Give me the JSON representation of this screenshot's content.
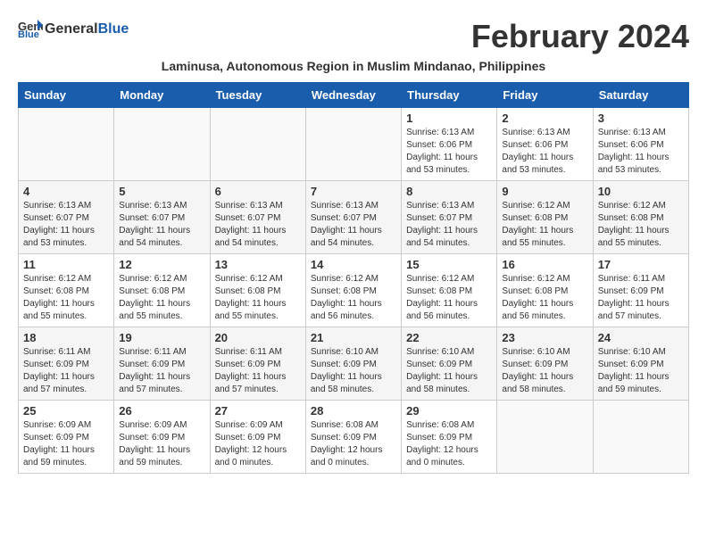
{
  "header": {
    "logo_general": "General",
    "logo_blue": "Blue",
    "month_title": "February 2024",
    "location": "Laminusa, Autonomous Region in Muslim Mindanao, Philippines"
  },
  "days_of_week": [
    "Sunday",
    "Monday",
    "Tuesday",
    "Wednesday",
    "Thursday",
    "Friday",
    "Saturday"
  ],
  "weeks": [
    [
      {
        "day": "",
        "info": ""
      },
      {
        "day": "",
        "info": ""
      },
      {
        "day": "",
        "info": ""
      },
      {
        "day": "",
        "info": ""
      },
      {
        "day": "1",
        "info": "Sunrise: 6:13 AM\nSunset: 6:06 PM\nDaylight: 11 hours\nand 53 minutes."
      },
      {
        "day": "2",
        "info": "Sunrise: 6:13 AM\nSunset: 6:06 PM\nDaylight: 11 hours\nand 53 minutes."
      },
      {
        "day": "3",
        "info": "Sunrise: 6:13 AM\nSunset: 6:06 PM\nDaylight: 11 hours\nand 53 minutes."
      }
    ],
    [
      {
        "day": "4",
        "info": "Sunrise: 6:13 AM\nSunset: 6:07 PM\nDaylight: 11 hours\nand 53 minutes."
      },
      {
        "day": "5",
        "info": "Sunrise: 6:13 AM\nSunset: 6:07 PM\nDaylight: 11 hours\nand 54 minutes."
      },
      {
        "day": "6",
        "info": "Sunrise: 6:13 AM\nSunset: 6:07 PM\nDaylight: 11 hours\nand 54 minutes."
      },
      {
        "day": "7",
        "info": "Sunrise: 6:13 AM\nSunset: 6:07 PM\nDaylight: 11 hours\nand 54 minutes."
      },
      {
        "day": "8",
        "info": "Sunrise: 6:13 AM\nSunset: 6:07 PM\nDaylight: 11 hours\nand 54 minutes."
      },
      {
        "day": "9",
        "info": "Sunrise: 6:12 AM\nSunset: 6:08 PM\nDaylight: 11 hours\nand 55 minutes."
      },
      {
        "day": "10",
        "info": "Sunrise: 6:12 AM\nSunset: 6:08 PM\nDaylight: 11 hours\nand 55 minutes."
      }
    ],
    [
      {
        "day": "11",
        "info": "Sunrise: 6:12 AM\nSunset: 6:08 PM\nDaylight: 11 hours\nand 55 minutes."
      },
      {
        "day": "12",
        "info": "Sunrise: 6:12 AM\nSunset: 6:08 PM\nDaylight: 11 hours\nand 55 minutes."
      },
      {
        "day": "13",
        "info": "Sunrise: 6:12 AM\nSunset: 6:08 PM\nDaylight: 11 hours\nand 55 minutes."
      },
      {
        "day": "14",
        "info": "Sunrise: 6:12 AM\nSunset: 6:08 PM\nDaylight: 11 hours\nand 56 minutes."
      },
      {
        "day": "15",
        "info": "Sunrise: 6:12 AM\nSunset: 6:08 PM\nDaylight: 11 hours\nand 56 minutes."
      },
      {
        "day": "16",
        "info": "Sunrise: 6:12 AM\nSunset: 6:08 PM\nDaylight: 11 hours\nand 56 minutes."
      },
      {
        "day": "17",
        "info": "Sunrise: 6:11 AM\nSunset: 6:09 PM\nDaylight: 11 hours\nand 57 minutes."
      }
    ],
    [
      {
        "day": "18",
        "info": "Sunrise: 6:11 AM\nSunset: 6:09 PM\nDaylight: 11 hours\nand 57 minutes."
      },
      {
        "day": "19",
        "info": "Sunrise: 6:11 AM\nSunset: 6:09 PM\nDaylight: 11 hours\nand 57 minutes."
      },
      {
        "day": "20",
        "info": "Sunrise: 6:11 AM\nSunset: 6:09 PM\nDaylight: 11 hours\nand 57 minutes."
      },
      {
        "day": "21",
        "info": "Sunrise: 6:10 AM\nSunset: 6:09 PM\nDaylight: 11 hours\nand 58 minutes."
      },
      {
        "day": "22",
        "info": "Sunrise: 6:10 AM\nSunset: 6:09 PM\nDaylight: 11 hours\nand 58 minutes."
      },
      {
        "day": "23",
        "info": "Sunrise: 6:10 AM\nSunset: 6:09 PM\nDaylight: 11 hours\nand 58 minutes."
      },
      {
        "day": "24",
        "info": "Sunrise: 6:10 AM\nSunset: 6:09 PM\nDaylight: 11 hours\nand 59 minutes."
      }
    ],
    [
      {
        "day": "25",
        "info": "Sunrise: 6:09 AM\nSunset: 6:09 PM\nDaylight: 11 hours\nand 59 minutes."
      },
      {
        "day": "26",
        "info": "Sunrise: 6:09 AM\nSunset: 6:09 PM\nDaylight: 11 hours\nand 59 minutes."
      },
      {
        "day": "27",
        "info": "Sunrise: 6:09 AM\nSunset: 6:09 PM\nDaylight: 12 hours\nand 0 minutes."
      },
      {
        "day": "28",
        "info": "Sunrise: 6:08 AM\nSunset: 6:09 PM\nDaylight: 12 hours\nand 0 minutes."
      },
      {
        "day": "29",
        "info": "Sunrise: 6:08 AM\nSunset: 6:09 PM\nDaylight: 12 hours\nand 0 minutes."
      },
      {
        "day": "",
        "info": ""
      },
      {
        "day": "",
        "info": ""
      }
    ]
  ]
}
